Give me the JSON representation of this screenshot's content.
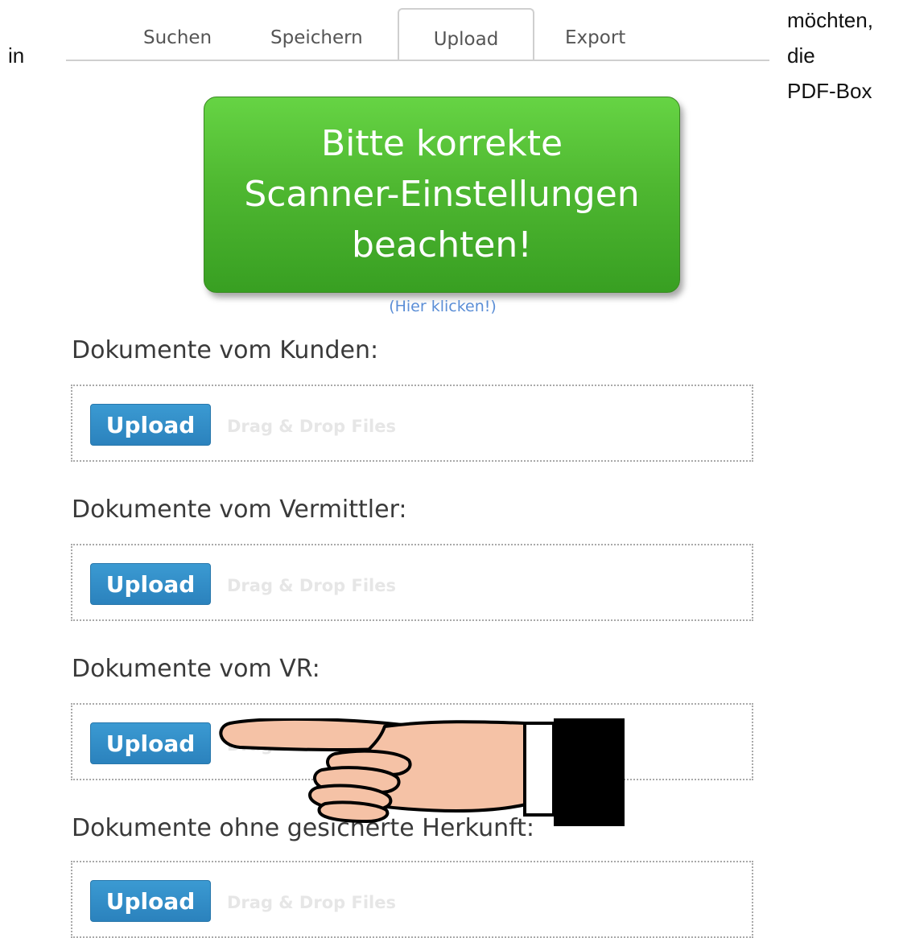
{
  "side_text": {
    "left": "in",
    "right_lines": [
      "möchten,",
      "die",
      "PDF-Box"
    ]
  },
  "tabs": [
    {
      "label": "Suchen",
      "active": false
    },
    {
      "label": "Speichern",
      "active": false
    },
    {
      "label": "Upload",
      "active": true
    },
    {
      "label": "Export",
      "active": false
    }
  ],
  "banner": {
    "lines": [
      "Bitte korrekte",
      "Scanner-Einstellungen",
      "beachten!"
    ],
    "link_text": "(Hier klicken!)",
    "color": "#4fb831"
  },
  "sections": [
    {
      "title": "Dokumente vom Kunden:",
      "button_label": "Upload",
      "drop_label": "Drag & Drop Files"
    },
    {
      "title": "Dokumente vom Vermittler:",
      "button_label": "Upload",
      "drop_label": "Drag & Drop Files"
    },
    {
      "title": "Dokumente vom VR:",
      "button_label": "Upload",
      "drop_label": "Drag & Drop Files"
    },
    {
      "title": "Dokumente ohne gesicherte Herkunft:",
      "button_label": "Upload",
      "drop_label": "Drag & Drop Files"
    }
  ],
  "overlay": {
    "icon": "pointing-hand-icon"
  },
  "colors": {
    "upload_button": "#2b82bd",
    "link": "#5b8ed6"
  }
}
